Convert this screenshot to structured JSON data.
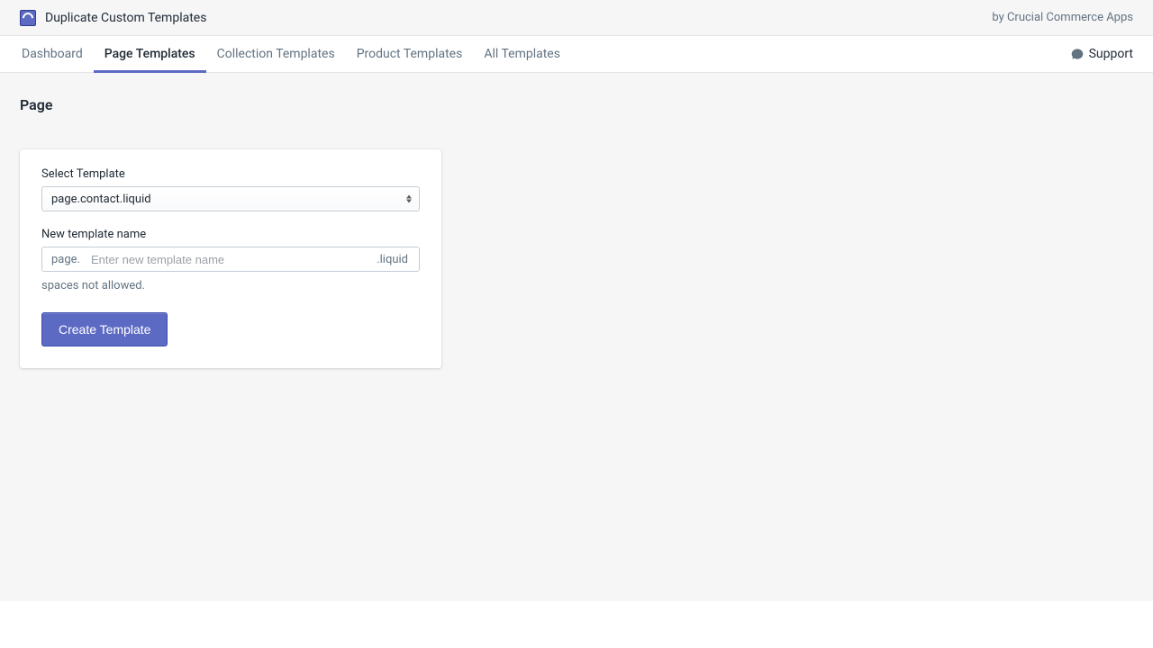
{
  "header": {
    "app_title": "Duplicate Custom Templates",
    "byline": "by Crucial Commerce Apps"
  },
  "nav": {
    "tabs": [
      {
        "label": "Dashboard",
        "active": false
      },
      {
        "label": "Page Templates",
        "active": true
      },
      {
        "label": "Collection Templates",
        "active": false
      },
      {
        "label": "Product Templates",
        "active": false
      },
      {
        "label": "All Templates",
        "active": false
      }
    ],
    "support": "Support"
  },
  "page": {
    "title": "Page",
    "select_label": "Select Template",
    "select_value": "page.contact.liquid",
    "name_label": "New template name",
    "name_prefix": "page.",
    "name_placeholder": "Enter new template name",
    "name_suffix": ".liquid",
    "helper": "spaces not allowed.",
    "create_button": "Create Template"
  }
}
